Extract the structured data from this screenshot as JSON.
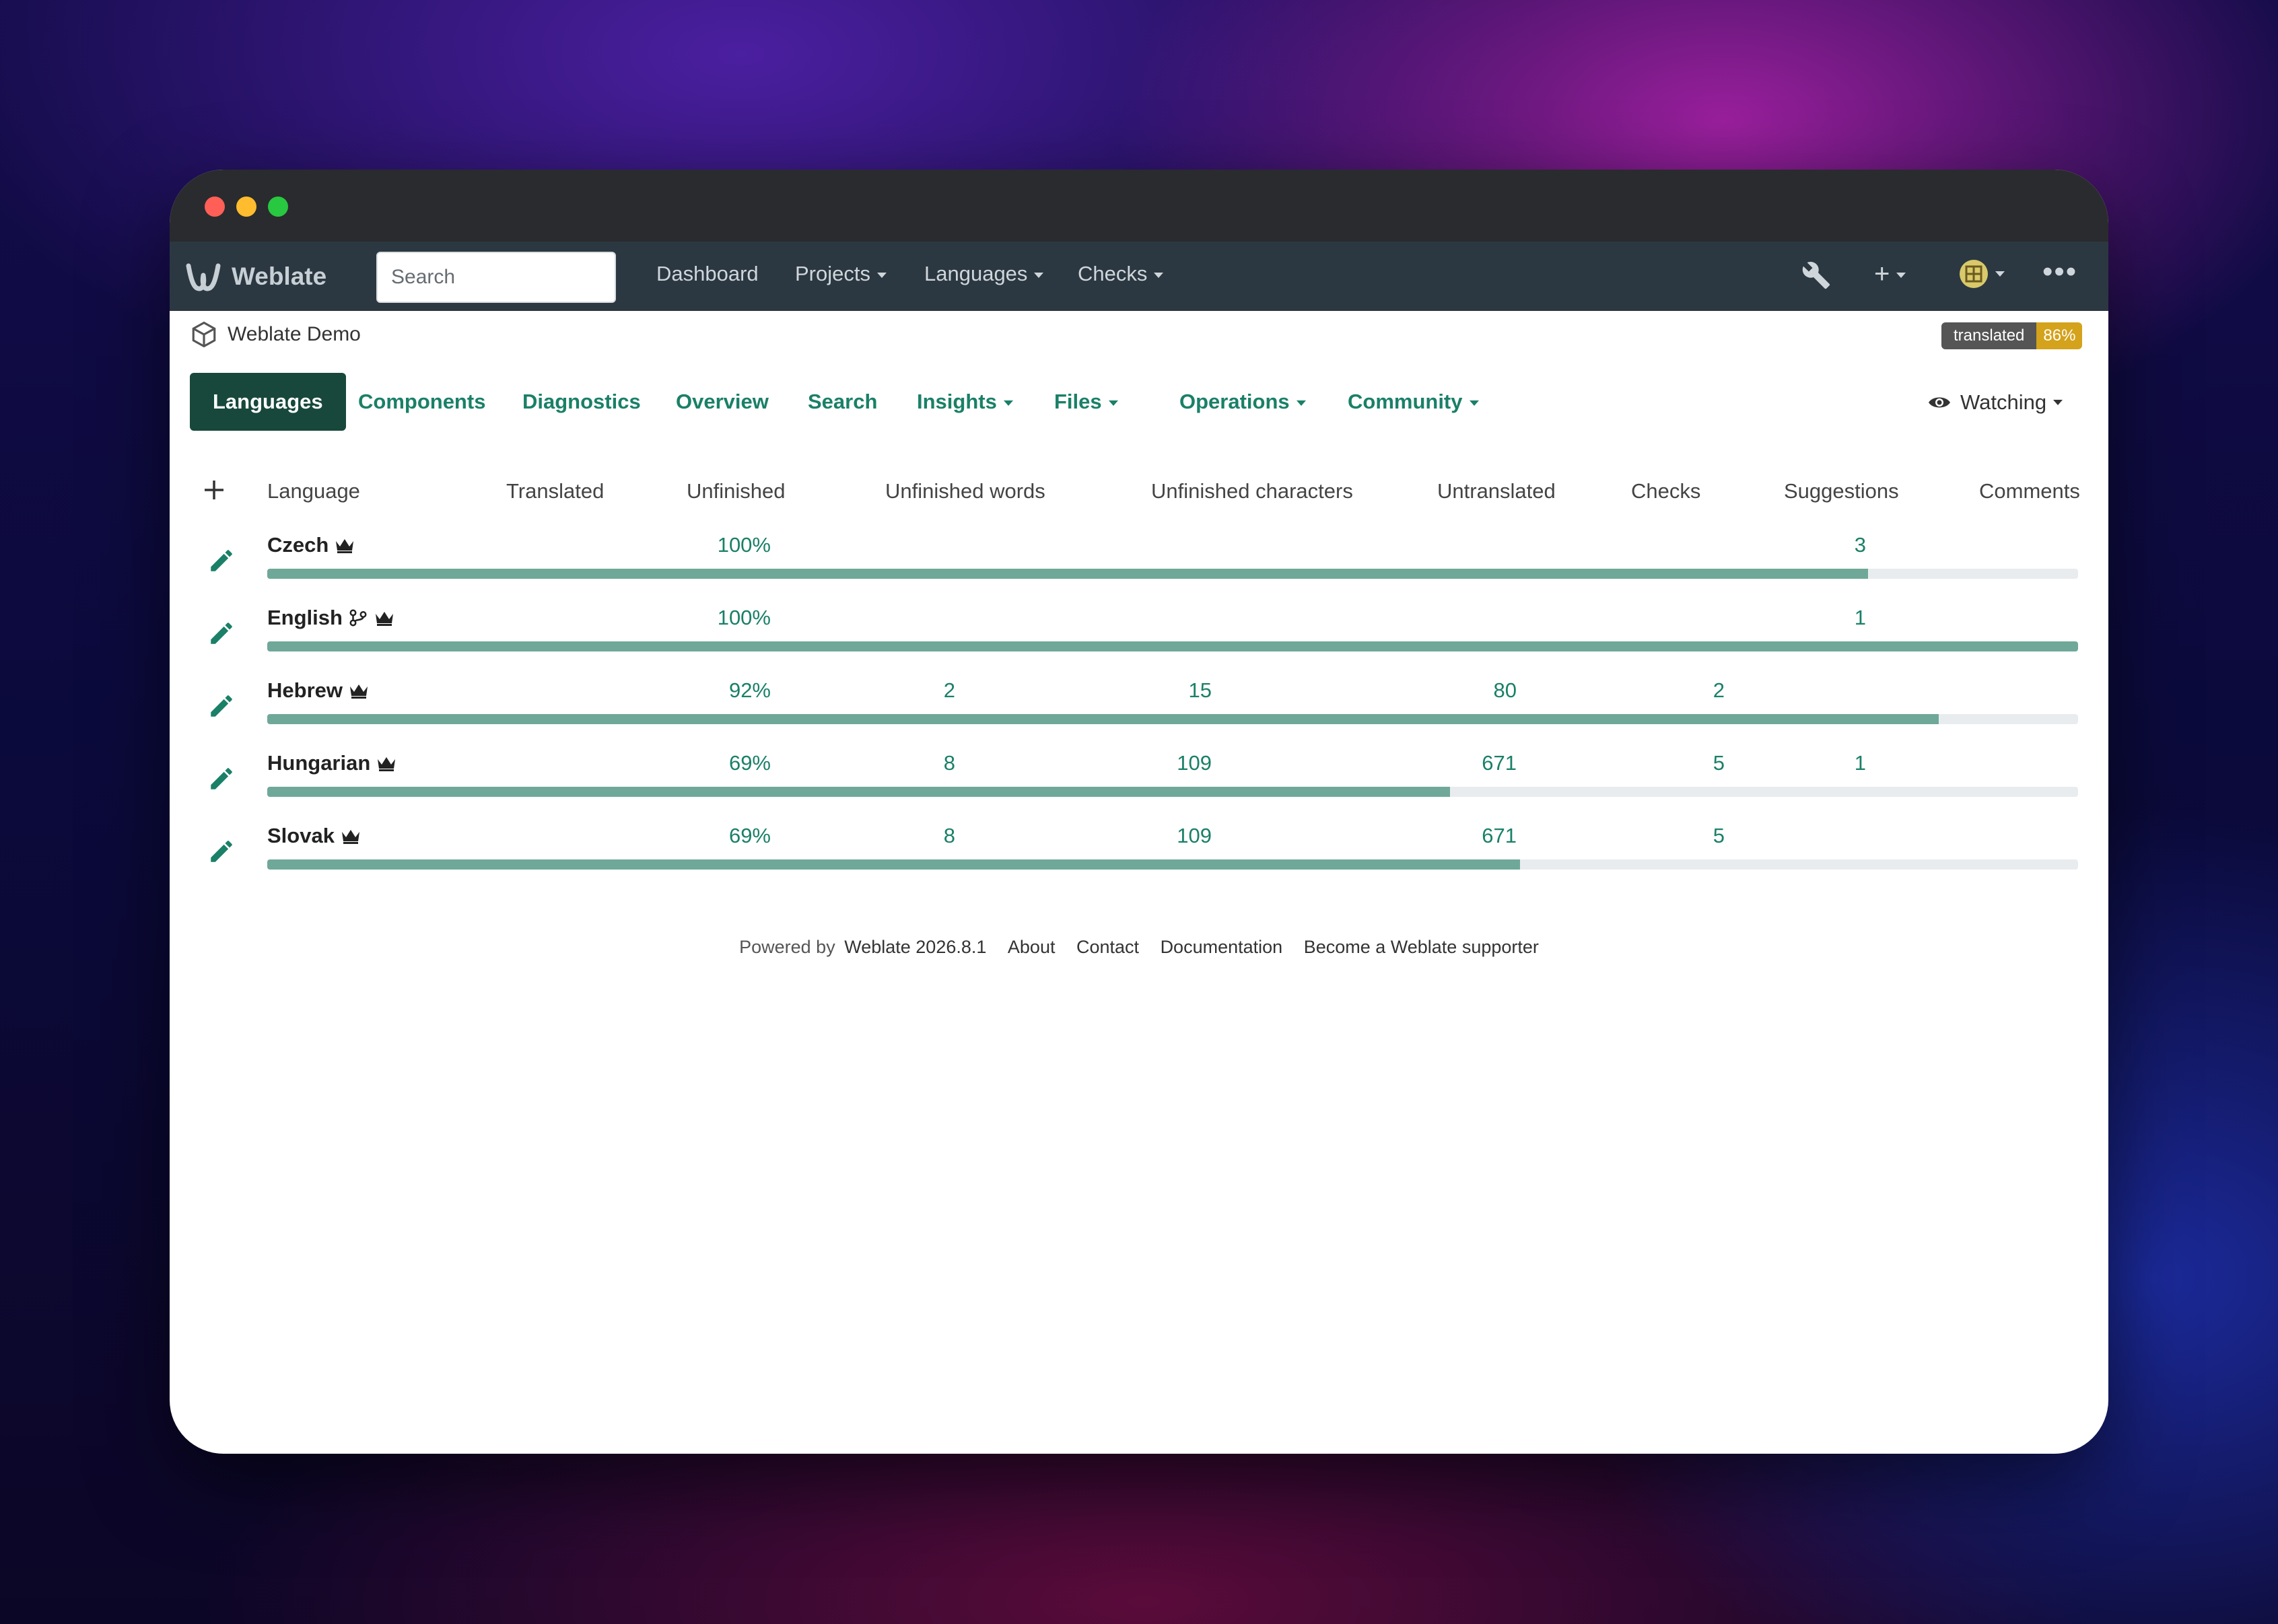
{
  "navbar": {
    "brand": "Weblate",
    "search_placeholder": "Search",
    "links": [
      "Dashboard",
      "Projects",
      "Languages",
      "Checks"
    ]
  },
  "breadcrumb": {
    "project": "Weblate Demo"
  },
  "badge": {
    "label": "translated",
    "value": "86%"
  },
  "tabs": [
    "Languages",
    "Components",
    "Diagnostics",
    "Overview",
    "Search",
    "Insights",
    "Files",
    "Operations",
    "Community"
  ],
  "watching": "Watching",
  "table": {
    "headers": [
      "Language",
      "Translated",
      "Unfinished",
      "Unfinished words",
      "Unfinished characters",
      "Untranslated",
      "Checks",
      "Suggestions",
      "Comments"
    ],
    "rows": [
      {
        "language": "Czech",
        "translated": "100%",
        "unfinished": "",
        "unfinished_words": "",
        "unfinished_chars": "",
        "untranslated": "",
        "checks": "3",
        "progress": 0.884
      },
      {
        "language": "English",
        "translated": "100%",
        "unfinished": "",
        "unfinished_words": "",
        "unfinished_chars": "",
        "untranslated": "",
        "checks": "1",
        "progress": 1.0
      },
      {
        "language": "Hebrew",
        "translated": "92%",
        "unfinished": "2",
        "unfinished_words": "15",
        "unfinished_chars": "80",
        "untranslated": "2",
        "checks": "",
        "progress": 0.923
      },
      {
        "language": "Hungarian",
        "translated": "69%",
        "unfinished": "8",
        "unfinished_words": "109",
        "unfinished_chars": "671",
        "untranslated": "5",
        "checks": "1",
        "progress": 0.653
      },
      {
        "language": "Slovak",
        "translated": "69%",
        "unfinished": "8",
        "unfinished_words": "109",
        "unfinished_chars": "671",
        "untranslated": "5",
        "checks": "",
        "progress": 0.692
      }
    ]
  },
  "footer": {
    "powered_by": "Powered by",
    "version": "Weblate 2026.8.1",
    "links": [
      "About",
      "Contact",
      "Documentation",
      "Become a Weblate supporter"
    ]
  },
  "colors": {
    "navbar": "#2b3841",
    "accent": "#1a8068",
    "active_tab": "#17483b",
    "bar": "#6fa898",
    "badge": "#d4a21b"
  }
}
